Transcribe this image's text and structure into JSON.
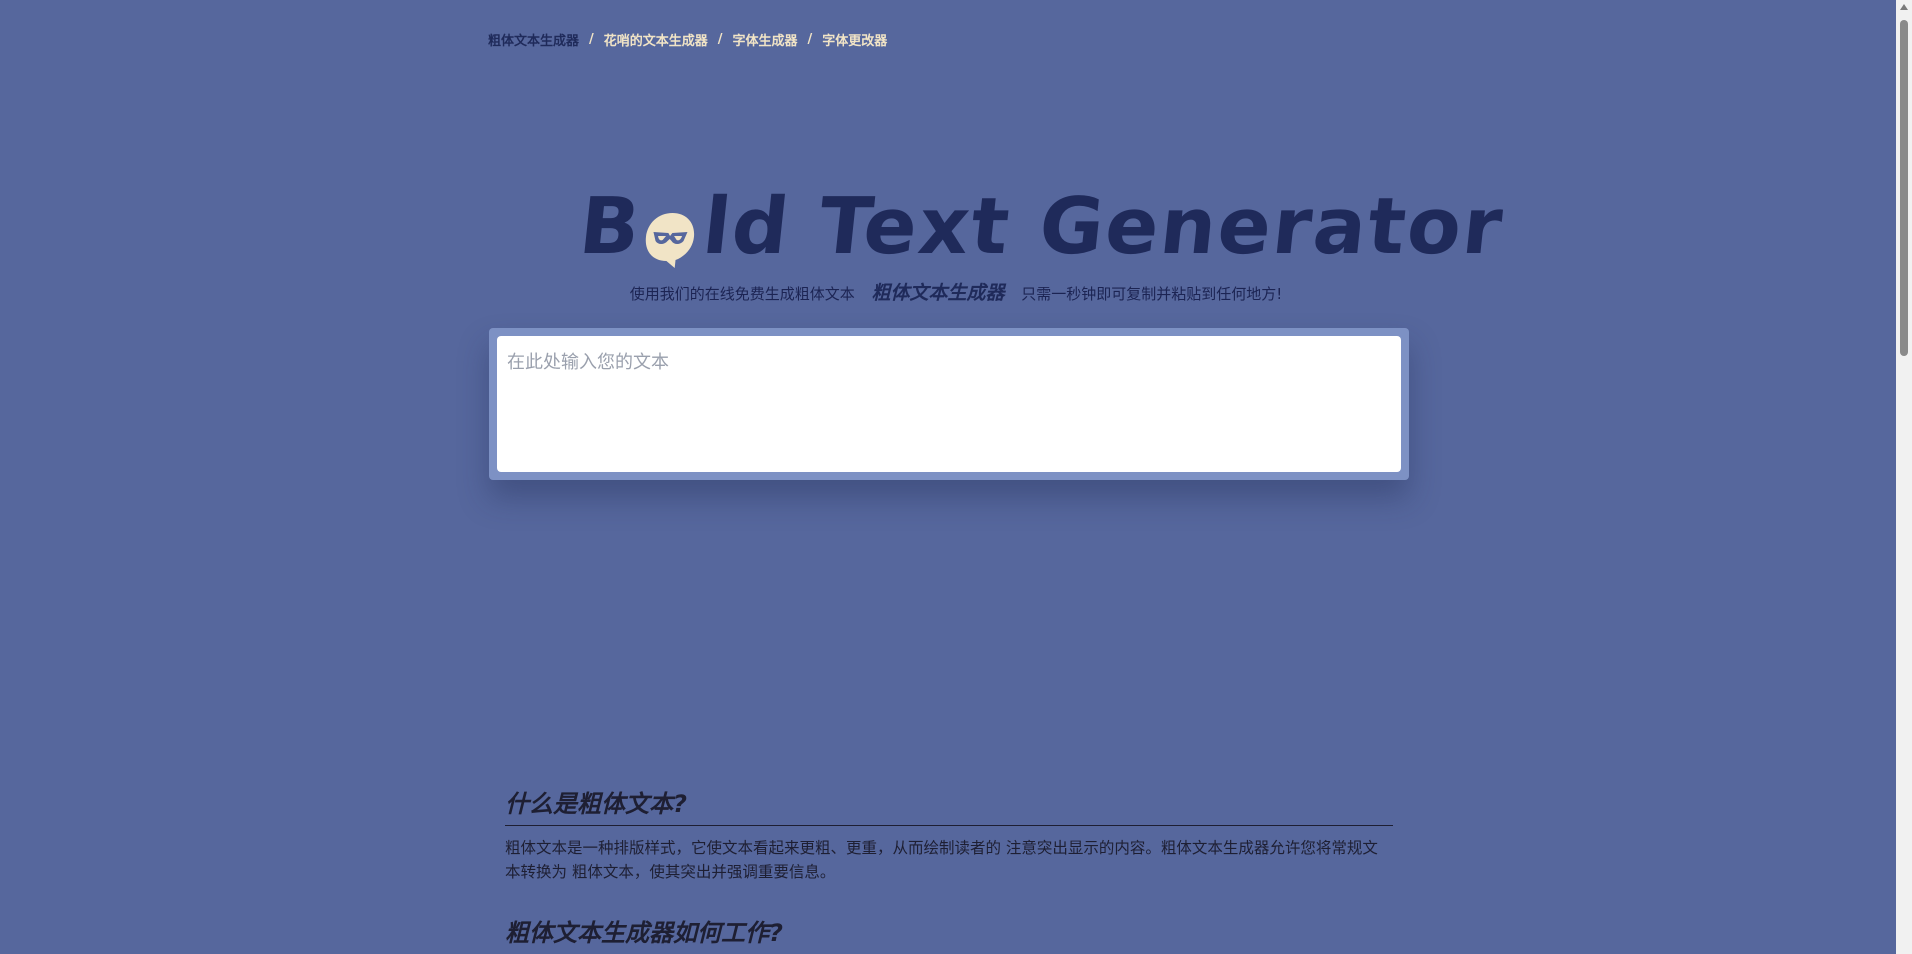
{
  "nav": {
    "items": [
      {
        "label": "粗体文本生成器",
        "active": true
      },
      {
        "label": "花哨的文本生成器",
        "active": false
      },
      {
        "label": "字体生成器",
        "active": false
      },
      {
        "label": "字体更改器",
        "active": false
      }
    ],
    "separator": "/"
  },
  "logo": {
    "before": "B",
    "after": "ld Text Generator",
    "icon": "mask-speech-bubble-icon"
  },
  "subtitle": {
    "part1": "使用我们的在线免费生成粗体文本",
    "emph": "粗体文本生成器",
    "part2": "只需一秒钟即可复制并粘贴到任何地方!"
  },
  "input": {
    "placeholder": "在此处输入您的文本",
    "value": ""
  },
  "sections": [
    {
      "heading": "什么是粗体文本?",
      "body": "粗体文本是一种排版样式，它使文本看起来更粗、更重，从而绘制读者的 注意突出显示的内容。粗体文本生成器允许您将常规文本转换为 粗体文本，使其突出并强调重要信息。"
    },
    {
      "heading": "粗体文本生成器如何工作?",
      "body": ""
    }
  ],
  "colors": {
    "background": "#56679d",
    "logo": "#1f2a5a",
    "nav_link": "#f1e4c6",
    "bubble": "#f1e4c6"
  }
}
